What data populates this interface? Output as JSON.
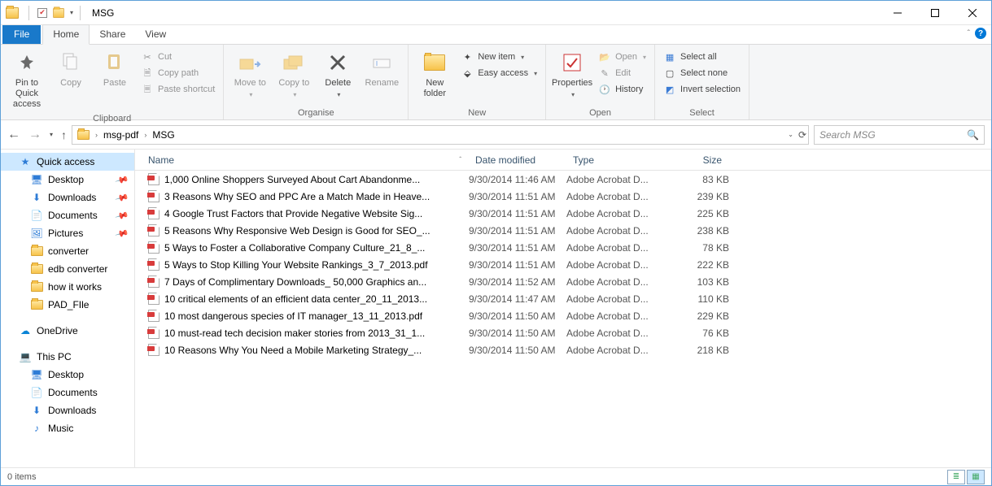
{
  "window": {
    "title": "MSG"
  },
  "tabs": {
    "file": "File",
    "home": "Home",
    "share": "Share",
    "view": "View"
  },
  "ribbon": {
    "clipboard": {
      "label": "Clipboard",
      "pin": "Pin to Quick access",
      "copy": "Copy",
      "paste": "Paste",
      "cut": "Cut",
      "copypath": "Copy path",
      "pasteshortcut": "Paste shortcut"
    },
    "organise": {
      "label": "Organise",
      "moveto": "Move to",
      "copyto": "Copy to",
      "delete": "Delete",
      "rename": "Rename"
    },
    "new": {
      "label": "New",
      "newfolder": "New folder",
      "newitem": "New item",
      "easyaccess": "Easy access"
    },
    "open": {
      "label": "Open",
      "properties": "Properties",
      "open": "Open",
      "edit": "Edit",
      "history": "History"
    },
    "select": {
      "label": "Select",
      "selectall": "Select all",
      "selectnone": "Select none",
      "invert": "Invert selection"
    }
  },
  "breadcrumb": {
    "seg1": "msg-pdf",
    "seg2": "MSG"
  },
  "search": {
    "placeholder": "Search MSG"
  },
  "sidebar": {
    "quickaccess": "Quick access",
    "desktop": "Desktop",
    "downloads": "Downloads",
    "documents": "Documents",
    "pictures": "Pictures",
    "converter": "converter",
    "edb": "edb converter",
    "how": "how it works",
    "pad": "PAD_FIle",
    "onedrive": "OneDrive",
    "thispc": "This PC",
    "desktop2": "Desktop",
    "documents2": "Documents",
    "downloads2": "Downloads",
    "music": "Music"
  },
  "columns": {
    "name": "Name",
    "date": "Date modified",
    "type": "Type",
    "size": "Size"
  },
  "files": [
    {
      "name": "1,000 Online Shoppers Surveyed About Cart Abandonme...",
      "date": "9/30/2014 11:46 AM",
      "type": "Adobe Acrobat D...",
      "size": "83 KB"
    },
    {
      "name": "3 Reasons Why SEO and PPC Are a Match Made in Heave...",
      "date": "9/30/2014 11:51 AM",
      "type": "Adobe Acrobat D...",
      "size": "239 KB"
    },
    {
      "name": "4 Google Trust Factors that Provide Negative Website Sig...",
      "date": "9/30/2014 11:51 AM",
      "type": "Adobe Acrobat D...",
      "size": "225 KB"
    },
    {
      "name": "5 Reasons Why Responsive Web Design is Good for SEO_...",
      "date": "9/30/2014 11:51 AM",
      "type": "Adobe Acrobat D...",
      "size": "238 KB"
    },
    {
      "name": "5 Ways to Foster a Collaborative Company Culture_21_8_...",
      "date": "9/30/2014 11:51 AM",
      "type": "Adobe Acrobat D...",
      "size": "78 KB"
    },
    {
      "name": "5 Ways to Stop Killing Your Website Rankings_3_7_2013.pdf",
      "date": "9/30/2014 11:51 AM",
      "type": "Adobe Acrobat D...",
      "size": "222 KB"
    },
    {
      "name": "7 Days of Complimentary Downloads_ 50,000 Graphics an...",
      "date": "9/30/2014 11:52 AM",
      "type": "Adobe Acrobat D...",
      "size": "103 KB"
    },
    {
      "name": "10 critical elements of an efficient data center_20_11_2013...",
      "date": "9/30/2014 11:47 AM",
      "type": "Adobe Acrobat D...",
      "size": "110 KB"
    },
    {
      "name": "10 most dangerous species of IT manager_13_11_2013.pdf",
      "date": "9/30/2014 11:50 AM",
      "type": "Adobe Acrobat D...",
      "size": "229 KB"
    },
    {
      "name": "10 must-read tech decision maker stories from 2013_31_1...",
      "date": "9/30/2014 11:50 AM",
      "type": "Adobe Acrobat D...",
      "size": "76 KB"
    },
    {
      "name": "10 Reasons Why You Need a Mobile Marketing Strategy_...",
      "date": "9/30/2014 11:50 AM",
      "type": "Adobe Acrobat D...",
      "size": "218 KB"
    }
  ],
  "status": {
    "items": "0 items"
  }
}
